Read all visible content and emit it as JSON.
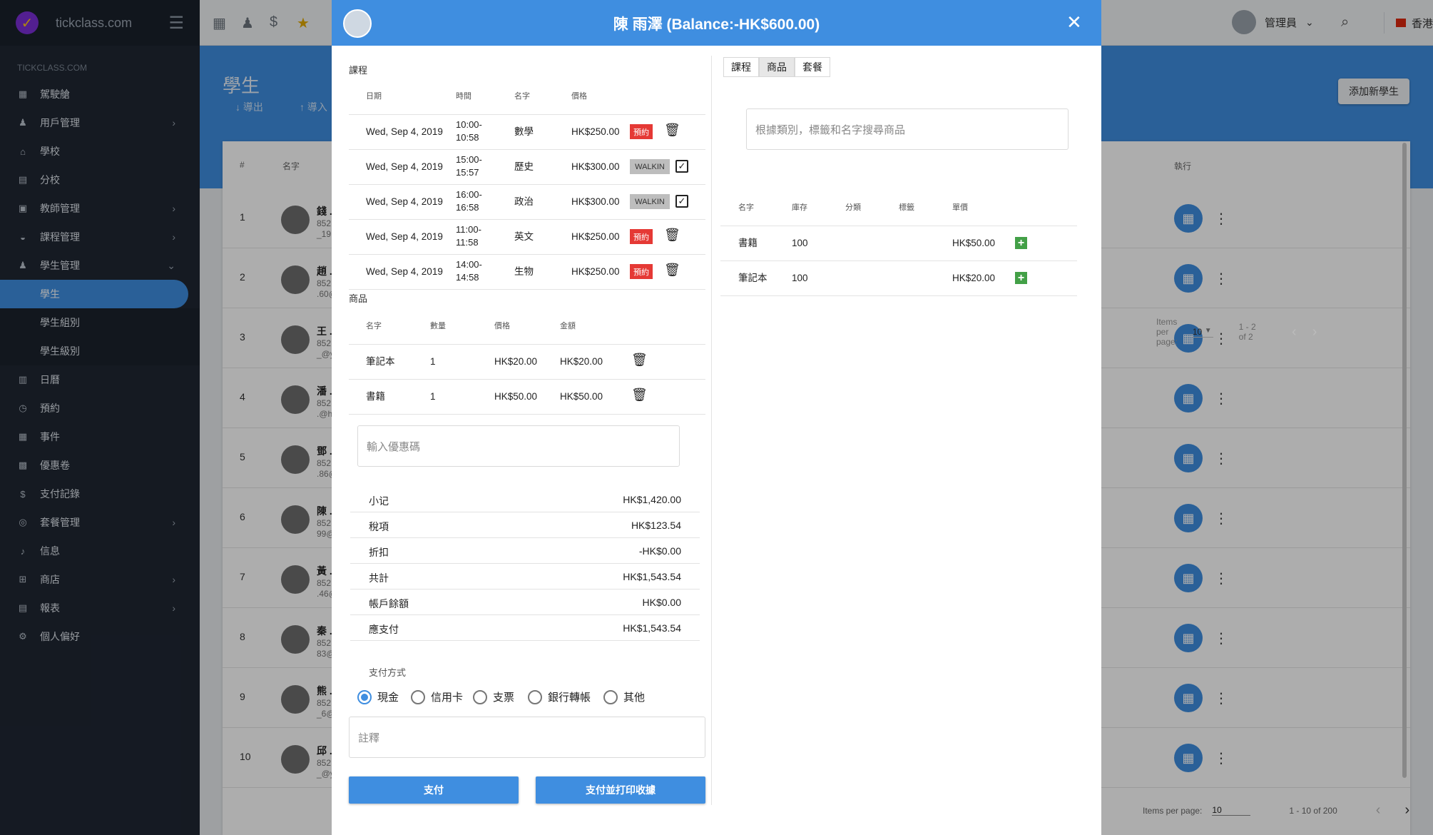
{
  "sidebar": {
    "brand": "tickclass.com",
    "section": "TICKCLASS.COM",
    "items": [
      {
        "label": "駕駛艙",
        "icon": "▦"
      },
      {
        "label": "用戶管理",
        "icon": "♟",
        "arrow": "›"
      },
      {
        "label": "學校",
        "icon": "⌂"
      },
      {
        "label": "分校",
        "icon": "▤"
      },
      {
        "label": "教師管理",
        "icon": "▣",
        "arrow": "›"
      },
      {
        "label": "課程管理",
        "icon": "◒",
        "arrow": "›"
      },
      {
        "label": "學生管理",
        "icon": "♟",
        "arrow": "⌄"
      },
      {
        "label": "學生",
        "sub": true,
        "active": true
      },
      {
        "label": "學生組別",
        "sub": true
      },
      {
        "label": "學生級別",
        "sub": true
      },
      {
        "label": "日曆",
        "icon": "▥"
      },
      {
        "label": "預約",
        "icon": "◷"
      },
      {
        "label": "事件",
        "icon": "▦"
      },
      {
        "label": "優惠卷",
        "icon": "▩"
      },
      {
        "label": "支付記錄",
        "icon": "$"
      },
      {
        "label": "套餐管理",
        "icon": "◎",
        "arrow": "›"
      },
      {
        "label": "信息",
        "icon": "♪"
      },
      {
        "label": "商店",
        "icon": "⊞",
        "arrow": "›"
      },
      {
        "label": "報表",
        "icon": "▤",
        "arrow": "›"
      },
      {
        "label": "個人偏好",
        "icon": "⚙"
      }
    ]
  },
  "topbar": {
    "username": "管理員",
    "user_caret": "⌄",
    "language": "香港"
  },
  "page": {
    "title": "學生",
    "export": "↓ 導出",
    "import": "↑ 導入",
    "add_button": "添加新學生",
    "col_num": "#",
    "col_name": "名字",
    "col_action": "執行",
    "rows": [
      {
        "num": "1",
        "name": "錢 .",
        "sub": "852\n_19"
      },
      {
        "num": "2",
        "name": "趙 .",
        "sub": "852\n.60@"
      },
      {
        "num": "3",
        "name": "王 .",
        "sub": "852\n_@y"
      },
      {
        "num": "4",
        "name": "潘 .",
        "sub": "852\n.@h"
      },
      {
        "num": "5",
        "name": "鄧 .",
        "sub": "852\n.86@"
      },
      {
        "num": "6",
        "name": "陳 .",
        "sub": "852\n99@"
      },
      {
        "num": "7",
        "name": "黃 .",
        "sub": "852\n.46@"
      },
      {
        "num": "8",
        "name": "秦 .",
        "sub": "852\n83@"
      },
      {
        "num": "9",
        "name": "熊 .",
        "sub": "852\n_6@"
      },
      {
        "num": "10",
        "name": "邱 .",
        "sub": "852\n_@y"
      }
    ],
    "pager_label": "Items per page:",
    "pager_size": "10",
    "pager_range": "1 - 10 of 200"
  },
  "modal": {
    "title": "陳 雨澤 (Balance:-HK$600.00)",
    "close": "✕",
    "courses_label": "課程",
    "course_headers": {
      "date": "日期",
      "time": "時間",
      "name": "名字",
      "price": "價格"
    },
    "courses": [
      {
        "date": "Wed, Sep 4, 2019",
        "time": "10:00-\n10:58",
        "name": "數學",
        "price": "HK$250.00",
        "tag": "預約",
        "kind": "res"
      },
      {
        "date": "Wed, Sep 4, 2019",
        "time": "15:00-\n15:57",
        "name": "歷史",
        "price": "HK$300.00",
        "tag": "WALKIN",
        "kind": "walk"
      },
      {
        "date": "Wed, Sep 4, 2019",
        "time": "16:00-\n16:58",
        "name": "政治",
        "price": "HK$300.00",
        "tag": "WALKIN",
        "kind": "walk"
      },
      {
        "date": "Wed, Sep 4, 2019",
        "time": "11:00-\n11:58",
        "name": "英文",
        "price": "HK$250.00",
        "tag": "預約",
        "kind": "res"
      },
      {
        "date": "Wed, Sep 4, 2019",
        "time": "14:00-\n14:58",
        "name": "生物",
        "price": "HK$250.00",
        "tag": "預約",
        "kind": "res"
      }
    ],
    "products_label": "商品",
    "product_headers": {
      "name": "名字",
      "qty": "數量",
      "price": "價格",
      "amount": "金額"
    },
    "products": [
      {
        "name": "筆記本",
        "qty": "1",
        "price": "HK$20.00",
        "amount": "HK$20.00"
      },
      {
        "name": "書籍",
        "qty": "1",
        "price": "HK$50.00",
        "amount": "HK$50.00"
      }
    ],
    "coupon_placeholder": "輸入優惠碼",
    "summary": [
      {
        "label": "小记",
        "value": "HK$1,420.00"
      },
      {
        "label": "稅項",
        "value": "HK$123.54"
      },
      {
        "label": "折扣",
        "value": "-HK$0.00"
      },
      {
        "label": "共計",
        "value": "HK$1,543.54"
      },
      {
        "label": "帳戶餘額",
        "value": "HK$0.00"
      },
      {
        "label": "應支付",
        "value": "HK$1,543.54"
      }
    ],
    "payment_label": "支付方式",
    "payment_methods": [
      {
        "label": "現金",
        "selected": true
      },
      {
        "label": "信用卡",
        "selected": false
      },
      {
        "label": "支票",
        "selected": false
      },
      {
        "label": "銀行轉帳",
        "selected": false
      },
      {
        "label": "其他",
        "selected": false
      }
    ],
    "remark_placeholder": "註釋",
    "pay_button": "支付",
    "pay_print_button": "支付並打印收據",
    "right": {
      "tabs": [
        {
          "label": "課程"
        },
        {
          "label": "商品",
          "active": true
        },
        {
          "label": "套餐"
        }
      ],
      "search_placeholder": "根據類別，標籤和名字搜尋商品",
      "headers": {
        "name": "名字",
        "stock": "庫存",
        "category": "分類",
        "tags": "標籤",
        "price": "單價"
      },
      "products": [
        {
          "name": "書籍",
          "stock": "100",
          "price": "HK$50.00"
        },
        {
          "name": "筆記本",
          "stock": "100",
          "price": "HK$20.00"
        }
      ],
      "pager_label": "Items per page:",
      "pager_size": "10",
      "pager_range": "1 - 2 of 2"
    }
  }
}
